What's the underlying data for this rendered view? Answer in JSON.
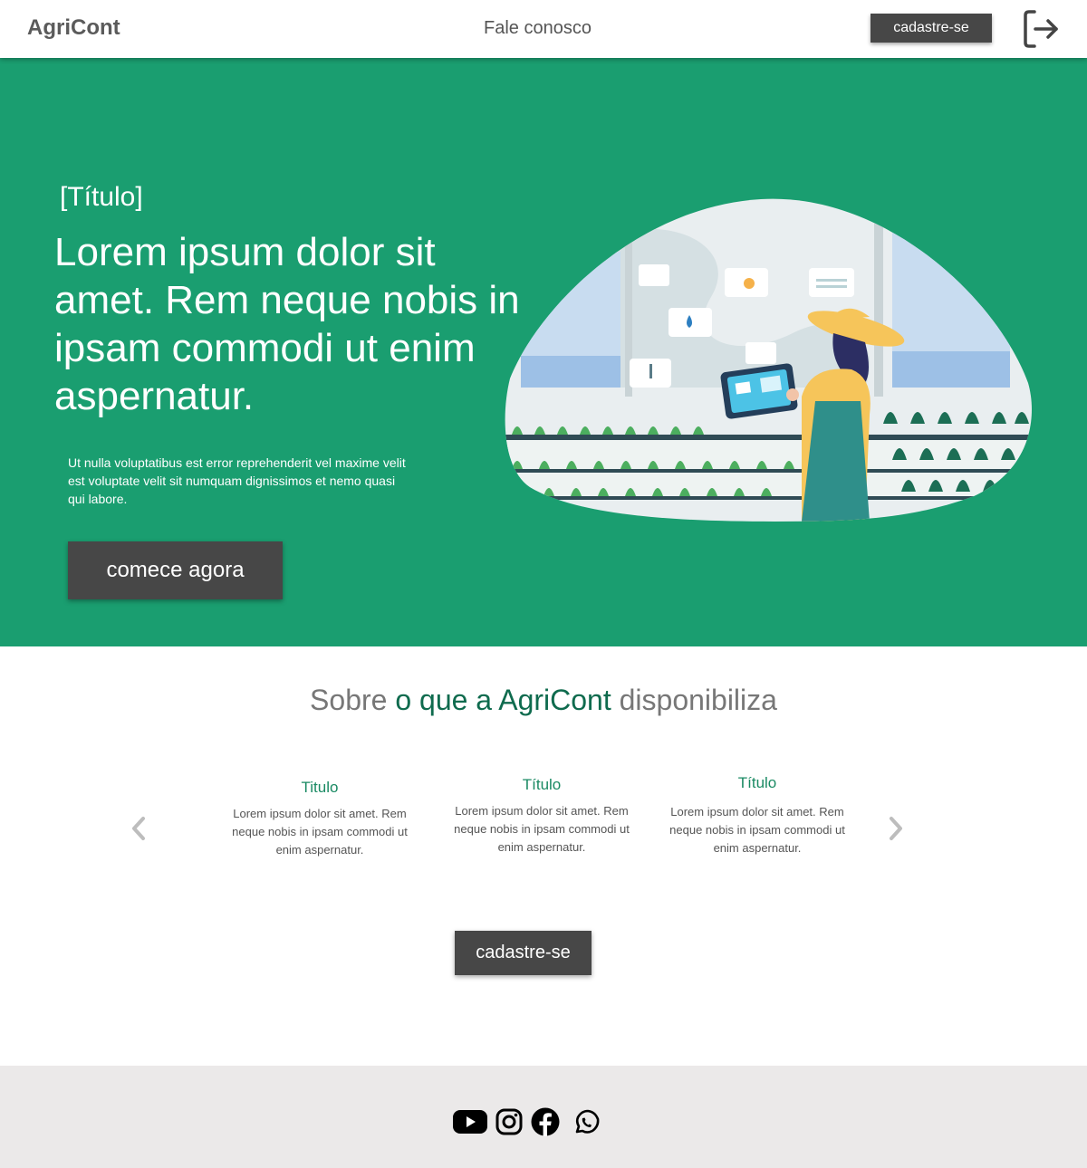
{
  "header": {
    "logo": "AgriCont",
    "contact_link": "Fale conosco",
    "cta_label": "cadastre-se",
    "logout_icon": "logout-icon"
  },
  "hero": {
    "tag": "[Título]",
    "heading": "Lorem ipsum dolor sit amet. Rem neque nobis in ipsam commodi ut enim aspernatur.",
    "text": "Ut nulla voluptatibus est error reprehenderit vel maxime velit est voluptate velit sit numquam dignissimos et nemo quasi qui labore.",
    "cta_label": "comece agora",
    "illustration": "farmer-greenhouse-tablet-illustration"
  },
  "about": {
    "title_prefix": "Sobre",
    "title_accent": "o que a AgriCont",
    "title_suffix": "disponibiliza",
    "features": [
      {
        "title": "Titulo",
        "text": "Lorem ipsum dolor sit amet. Rem neque nobis in ipsam commodi ut enim aspernatur."
      },
      {
        "title": "Título",
        "text": "Lorem ipsum dolor sit amet. Rem neque nobis in ipsam commodi ut enim aspernatur."
      },
      {
        "title": "Título",
        "text": "Lorem ipsum dolor sit amet. Rem neque nobis in ipsam commodi ut enim aspernatur."
      }
    ],
    "prev_icon": "chevron-left-icon",
    "next_icon": "chevron-right-icon",
    "cta_label": "cadastre-se"
  },
  "footer": {
    "social_icons": [
      "youtube-icon",
      "instagram-icon",
      "facebook-icon",
      "whatsapp-icon"
    ]
  },
  "colors": {
    "brand_green": "#1a9e70",
    "accent_green": "#0f6b4e",
    "button_dark": "#474747",
    "footer_bg": "#ebe9e9"
  }
}
